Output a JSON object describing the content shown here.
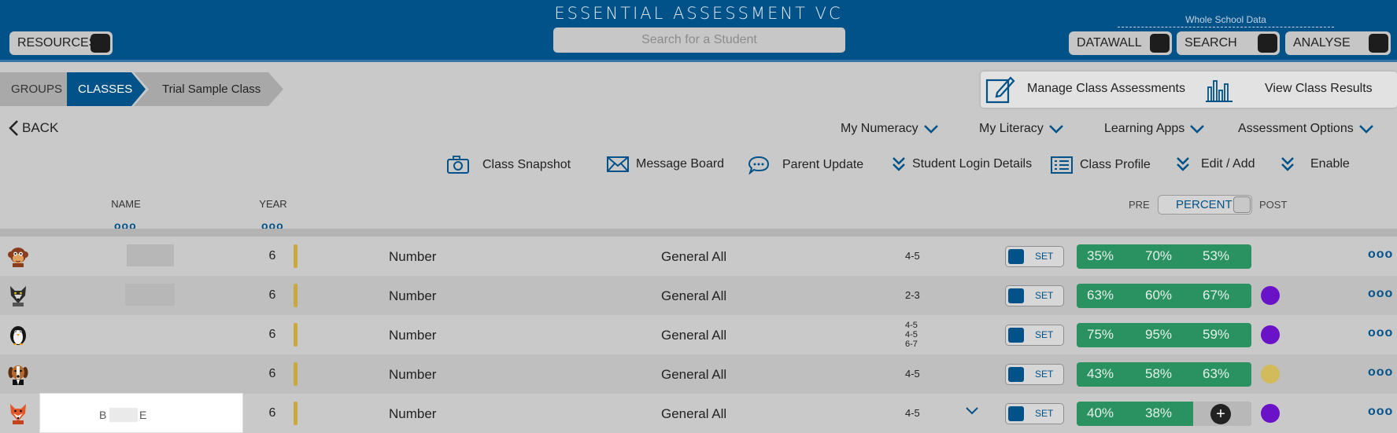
{
  "header": {
    "app_title": "ESSENTIAL ASSESSMENT VC",
    "search_placeholder": "Search for a Student",
    "resources_label": "RESOURCES",
    "whole_school_label": "Whole School Data",
    "datawall_label": "DATAWALL",
    "search_label": "SEARCH",
    "analyse_label": "ANALYSE"
  },
  "breadcrumb": {
    "groups": "GROUPS",
    "classes": "CLASSES",
    "current": "Trial Sample Class"
  },
  "manage": {
    "manage_label": "Manage Class Assessments",
    "results_label": "View Class Results"
  },
  "back_label": "BACK",
  "menus": {
    "numeracy": "My Numeracy",
    "literacy": "My Literacy",
    "apps": "Learning Apps",
    "options": "Assessment Options"
  },
  "actions": {
    "snapshot": "Class Snapshot",
    "message": "Message Board",
    "parent": "Parent Update",
    "login": "Student Login Details",
    "profile": "Class Profile",
    "edit": "Edit / Add",
    "enable": "Enable"
  },
  "columns": {
    "name": "NAME",
    "year": "YEAR",
    "more_dots": "ooo",
    "pre": "PRE",
    "percent": "PERCENT",
    "post": "POST"
  },
  "colors": {
    "brand": "#005288",
    "score_green": "#2a9160",
    "purple": "#6a12c8",
    "yellow": "#d2bb5a"
  },
  "students": [
    {
      "avatar": "monkey-icon",
      "year": "6",
      "subject": "Number",
      "group": "General All",
      "level": "4-5",
      "set_label": "SET",
      "scores": [
        "35%",
        "70%",
        "53%"
      ],
      "status_color": "",
      "more": "ooo"
    },
    {
      "avatar": "wolf-icon",
      "year": "6",
      "subject": "Number",
      "group": "General All",
      "level": "2-3",
      "set_label": "SET",
      "scores": [
        "63%",
        "60%",
        "67%"
      ],
      "status_color": "#6a12c8",
      "more": "ooo"
    },
    {
      "avatar": "penguin-icon",
      "year": "6",
      "subject": "Number",
      "group": "General All",
      "levels": [
        "4-5",
        "4-5",
        "6-7"
      ],
      "set_label": "SET",
      "scores": [
        "75%",
        "95%",
        "59%"
      ],
      "status_color": "#6a12c8",
      "more": "ooo"
    },
    {
      "avatar": "dog-icon",
      "year": "6",
      "subject": "Number",
      "group": "General All",
      "level": "4-5",
      "set_label": "SET",
      "scores": [
        "43%",
        "58%",
        "63%"
      ],
      "status_color": "#d2bb5a",
      "more": "ooo"
    },
    {
      "avatar": "fox-icon",
      "year": "6",
      "subject": "Number",
      "group": "General All",
      "level": "4-5",
      "set_label": "SET",
      "scores": [
        "40%",
        "38%"
      ],
      "status_color": "#6a12c8",
      "more": "ooo",
      "plus": "+"
    }
  ],
  "name_popup": {
    "first": "B",
    "last": "E"
  }
}
